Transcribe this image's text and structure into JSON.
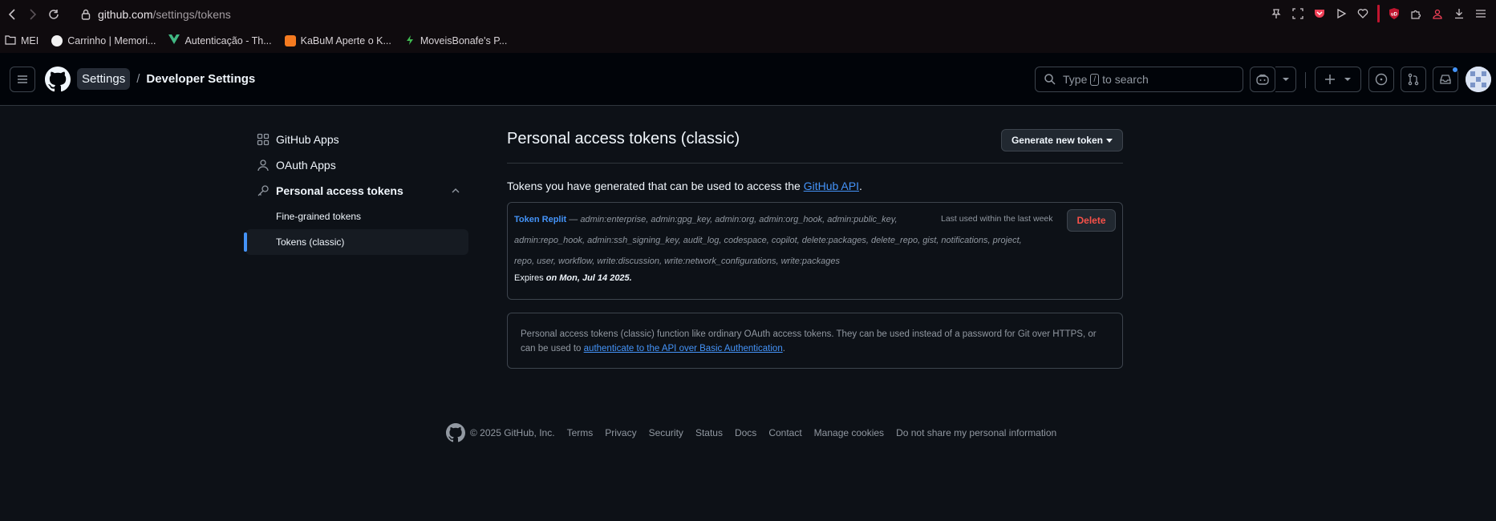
{
  "browser": {
    "url_host": "github.com",
    "url_path": "/settings/tokens",
    "bookmarks": [
      {
        "label": "MEI",
        "icon": "folder-icon"
      },
      {
        "label": "Carrinho | Memori...",
        "icon": "cart-favicon"
      },
      {
        "label": "Autenticação - Th...",
        "icon": "vue-favicon"
      },
      {
        "label": "KaBuM Aperte o K...",
        "icon": "kabum-favicon"
      },
      {
        "label": "MoveisBonafe's P...",
        "icon": "bolt-favicon"
      }
    ]
  },
  "header": {
    "crumb_settings": "Settings",
    "crumb_sep": "/",
    "crumb_dev": "Developer Settings",
    "search_prefix": "Type",
    "search_key": "/",
    "search_suffix": "to search"
  },
  "sidebar": {
    "items": [
      {
        "label": "GitHub Apps"
      },
      {
        "label": "OAuth Apps"
      },
      {
        "label": "Personal access tokens"
      }
    ],
    "sub_items": [
      {
        "label": "Fine-grained tokens"
      },
      {
        "label": "Tokens (classic)"
      }
    ]
  },
  "main": {
    "title": "Personal access tokens (classic)",
    "generate_button": "Generate new token",
    "desc_prefix": "Tokens you have generated that can be used to access the ",
    "desc_link": "GitHub API",
    "desc_suffix": ".",
    "token": {
      "name": "Token Replit",
      "scopes_line1": " — admin:enterprise, admin:gpg_key, admin:org, admin:org_hook, admin:public_key,",
      "scopes_line2": "admin:repo_hook, admin:ssh_signing_key, audit_log, codespace, copilot, delete:packages, delete_repo, gist, notifications, project,",
      "scopes_line3": "repo, user, workflow, write:discussion, write:network_configurations, write:packages",
      "expires_prefix": "Expires ",
      "expires_date": "on Mon, Jul 14 2025.",
      "last_used": "Last used within the last week",
      "delete_label": "Delete"
    },
    "info_text": "Personal access tokens (classic) function like ordinary OAuth access tokens. They can be used instead of a password for Git over HTTPS, or can be used to ",
    "info_link": "authenticate to the API over Basic Authentication",
    "info_suffix": "."
  },
  "footer": {
    "copyright": "© 2025 GitHub, Inc.",
    "links": [
      "Terms",
      "Privacy",
      "Security",
      "Status",
      "Docs",
      "Contact",
      "Manage cookies",
      "Do not share my personal information"
    ]
  },
  "colors": {
    "accent": "#4493f8",
    "danger": "#f85149",
    "bg": "#0d1117"
  }
}
